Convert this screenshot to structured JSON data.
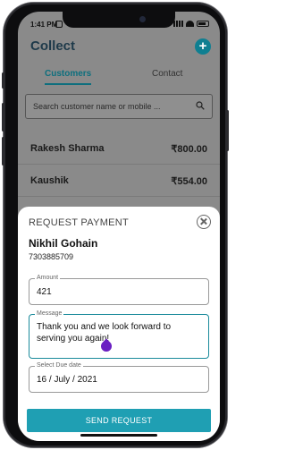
{
  "status_bar": {
    "time": "1:41 PM"
  },
  "header": {
    "title": "Collect",
    "add_label": "+"
  },
  "tabs": [
    {
      "label": "Customers",
      "active": true
    },
    {
      "label": "Contact",
      "active": false
    }
  ],
  "search": {
    "placeholder": "Search customer name or mobile ..."
  },
  "customers": [
    {
      "name": "Rakesh Sharma",
      "amount": "₹800.00"
    },
    {
      "name": "Kaushik",
      "amount": "₹554.00"
    }
  ],
  "sheet": {
    "title": "REQUEST PAYMENT",
    "payee_name": "Nikhil Gohain",
    "payee_phone": "7303885709",
    "amount": {
      "label": "Amount",
      "value": "421"
    },
    "message": {
      "label": "Message",
      "value": "Thank you and we look forward to serving you again!"
    },
    "due_date": {
      "label": "Select Due date",
      "value": "16 / July / 2021"
    },
    "send_label": "SEND REQUEST"
  },
  "colors": {
    "accent": "#1f9fb3",
    "title": "#1e3a4a",
    "cursor": "#6a1fc2"
  }
}
